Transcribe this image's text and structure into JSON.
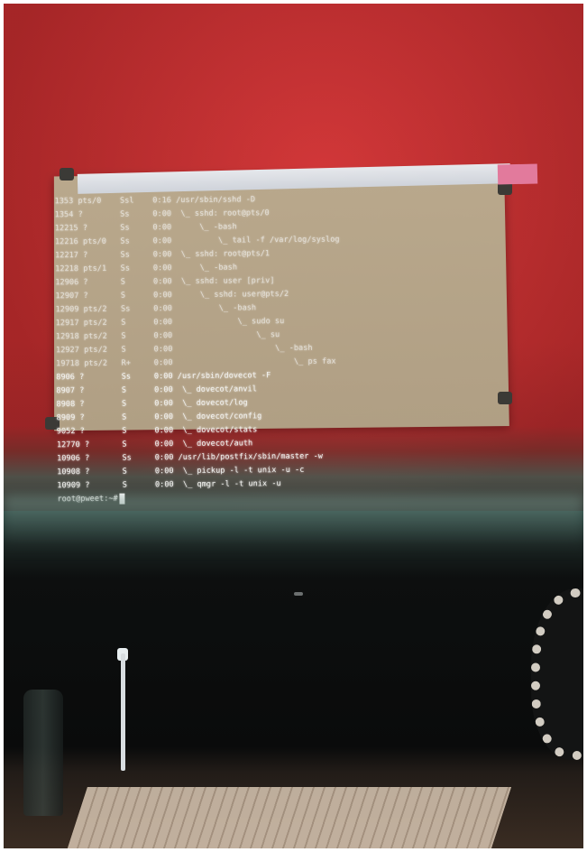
{
  "terminal": {
    "rows": [
      "1353 pts/0    Ssl    0:16 /usr/sbin/sshd -D",
      "1354 ?        Ss     0:00  \\_ sshd: root@pts/0",
      "12215 ?       Ss     0:00      \\_ -bash",
      "12216 pts/0   Ss     0:00          \\_ tail -f /var/log/syslog",
      "12217 ?       Ss     0:00  \\_ sshd: root@pts/1",
      "12218 pts/1   Ss     0:00      \\_ -bash",
      "12906 ?       S      0:00  \\_ sshd: user [priv]",
      "12907 ?       S      0:00      \\_ sshd: user@pts/2",
      "12909 pts/2   Ss     0:00          \\_ -bash",
      "12917 pts/2   S      0:00              \\_ sudo su",
      "12918 pts/2   S      0:00                  \\_ su",
      "12927 pts/2   S      0:00                      \\_ -bash",
      "19718 pts/2   R+     0:00                          \\_ ps fax",
      "8906 ?        Ss     0:00 /usr/sbin/dovecot -F",
      "8907 ?        S      0:00  \\_ dovecot/anvil",
      "8908 ?        S      0:00  \\_ dovecot/log",
      "8909 ?        S      0:00  \\_ dovecot/config",
      "9052 ?        S      0:00  \\_ dovecot/stats",
      "12770 ?       S      0:00  \\_ dovecot/auth",
      "10906 ?       Ss     0:00 /usr/lib/postfix/sbin/master -w",
      "10908 ?       S      0:00  \\_ pickup -l -t unix -u -c",
      "10909 ?       S      0:00  \\_ qmgr -l -t unix -u"
    ],
    "prompt": "root@pweet:~#"
  }
}
